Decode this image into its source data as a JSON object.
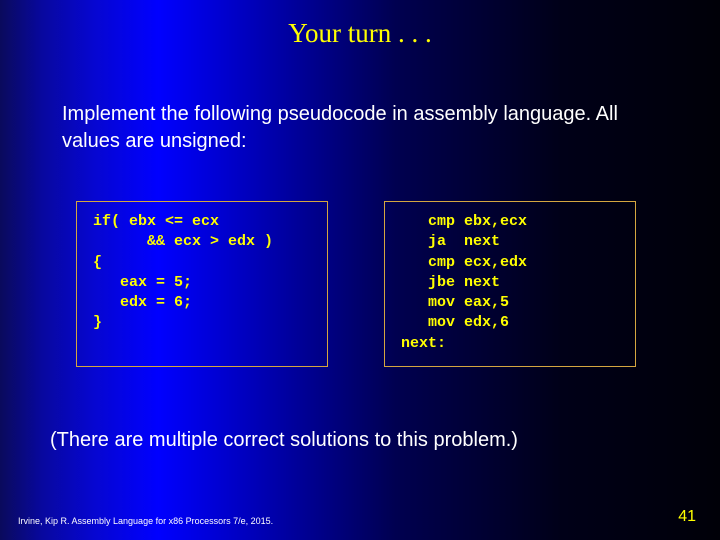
{
  "title": "Your turn . . .",
  "intro": "Implement the following pseudocode in assembly language. All values are unsigned:",
  "code_left": "if( ebx <= ecx\n      && ecx > edx )\n{\n   eax = 5;\n   edx = 6;\n}",
  "code_right": "   cmp ebx,ecx\n   ja  next\n   cmp ecx,edx\n   jbe next\n   mov eax,5\n   mov edx,6\nnext:",
  "note": "(There are multiple correct solutions to this problem.)",
  "footer": "Irvine, Kip R. Assembly Language for x86 Processors 7/e, 2015.",
  "pagenum": "41"
}
